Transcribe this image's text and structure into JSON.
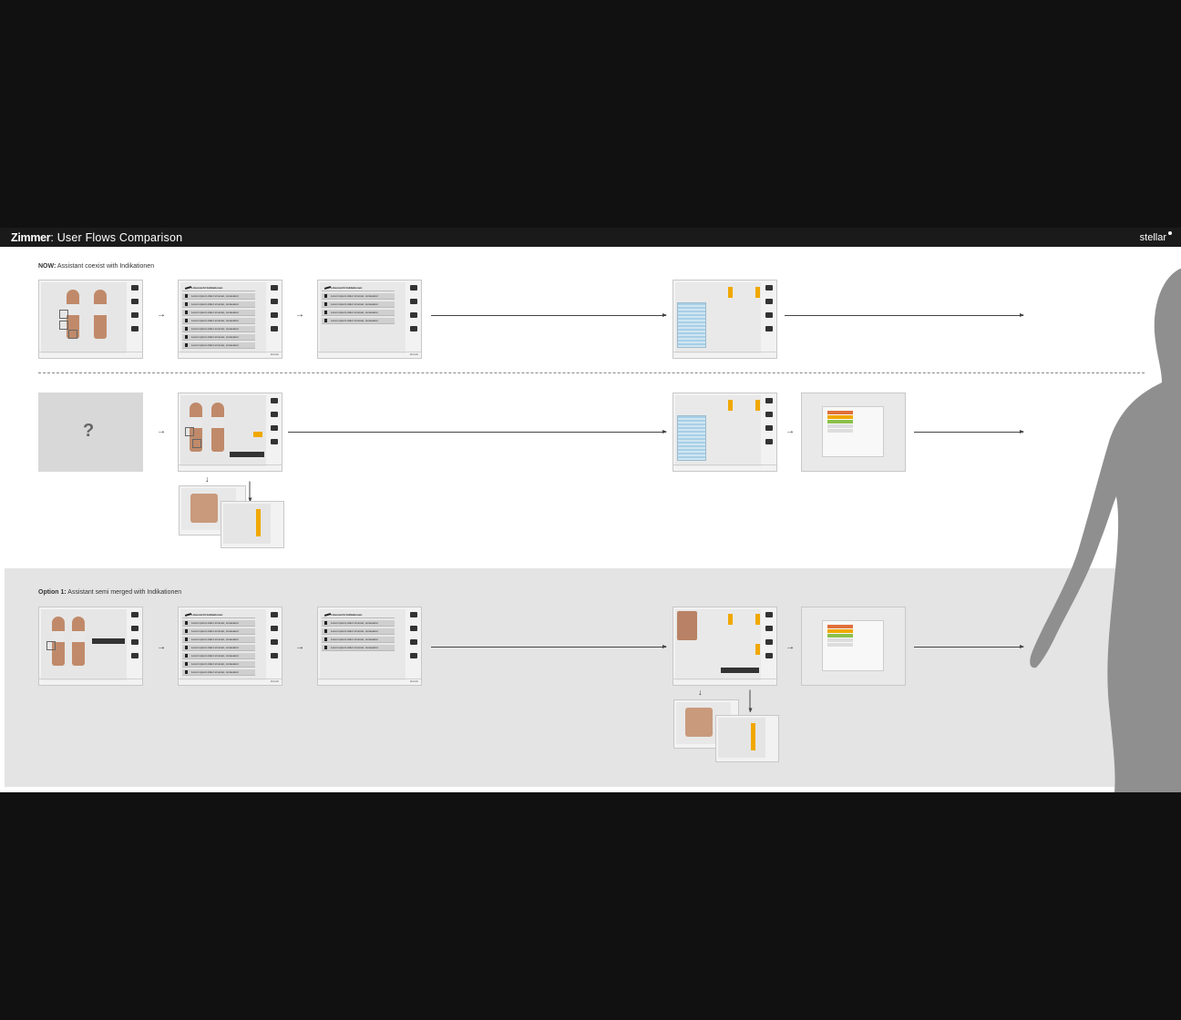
{
  "header": {
    "brand": "Zimmer",
    "title": ": User Flows Comparison",
    "logo": "stellar"
  },
  "sections": {
    "now_bold": "NOW:",
    "now_text": "Assistant coexist with Indikationen",
    "option_bold": "Option 1:",
    "option_text": "Assistant semi merged with Indikationen"
  },
  "placeholder": {
    "glyph": "?"
  },
  "arrow_glyph": "→",
  "down_glyph": "↓",
  "list_screen": {
    "head": "Liniensicht Indikationen",
    "row": "Lorem ipsum dolor sit amet, consetetur",
    "foot": "Zurück"
  },
  "colors": {
    "header_bg": "#1a1a1a",
    "option_bg": "#e4e4e4",
    "accent_orange": "#f0a800",
    "gauge_blue": "#a8cfe6",
    "silhouette": "#8f8f8f"
  }
}
